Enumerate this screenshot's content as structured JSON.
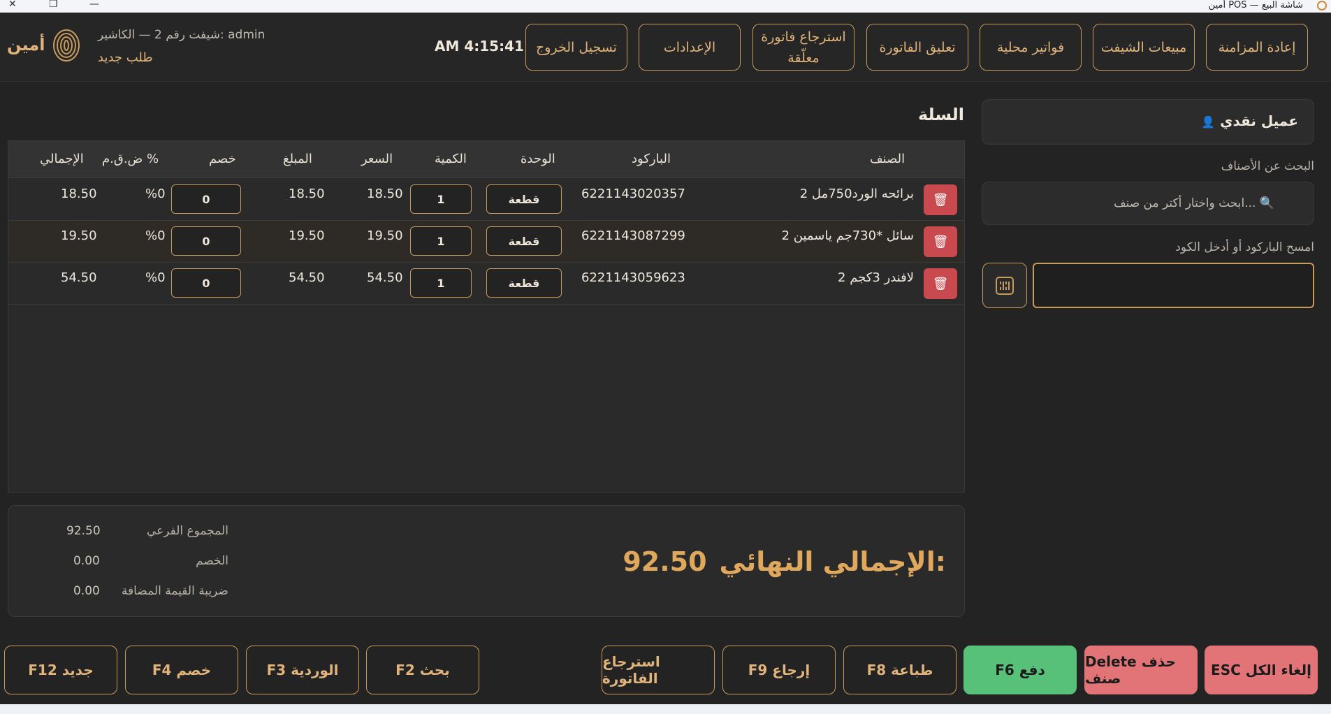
{
  "window": {
    "title": "أمين POS — شاشة البيع"
  },
  "header": {
    "buttons": [
      {
        "label": "إعادة المزامنة"
      },
      {
        "label": "مبيعات الشيفت"
      },
      {
        "label": "فواتير محلية"
      },
      {
        "label": "تعليق الفاتورة"
      },
      {
        "label": "استرجاع فاتورة معلّقة"
      },
      {
        "label": "الإعدادات"
      },
      {
        "label": "تسجيل الخروج"
      }
    ],
    "clock": "AM 4:15:41",
    "shift_info": "شيفت رقم 2 — الكاشير: admin",
    "new_order": "طلب جديد",
    "brand": "أمين"
  },
  "customer": {
    "label": "عميل نقدي",
    "icon": "user-icon"
  },
  "search": {
    "label": "البحث عن الأصناف",
    "placeholder": "ابحث واختار أكتر من صنف..."
  },
  "barcode": {
    "label": "امسح الباركود أو أدخل الكود",
    "value": ""
  },
  "cart": {
    "title": "السلة",
    "columns": {
      "item": "الصنف",
      "barcode": "الباركود",
      "unit": "الوحدة",
      "qty": "الكمية",
      "price": "السعر",
      "amount": "المبلغ",
      "discount": "خصم",
      "vat": "ض.ق.م %",
      "total": "الإجمالي"
    },
    "rows": [
      {
        "item": "2 برائحه الورد750مل",
        "barcode": "6221143020357",
        "unit": "قطعة",
        "qty": "1",
        "price": "18.50",
        "amount": "18.50",
        "discount": "0",
        "vat": "%0",
        "total": "18.50"
      },
      {
        "item": "2 سائل *730جم ياسمين",
        "barcode": "6221143087299",
        "unit": "قطعة",
        "qty": "1",
        "price": "19.50",
        "amount": "19.50",
        "discount": "0",
        "vat": "%0",
        "total": "19.50"
      },
      {
        "item": "2 لافندر 3كجم",
        "barcode": "6221143059623",
        "unit": "قطعة",
        "qty": "1",
        "price": "54.50",
        "amount": "54.50",
        "discount": "0",
        "vat": "%0",
        "total": "54.50"
      }
    ]
  },
  "totals": {
    "subtotal_label": "المجموع الفرعي",
    "subtotal": "92.50",
    "discount_label": "الخصم",
    "discount": "0.00",
    "vat_label": "ضريبة القيمة المضافة",
    "vat": "0.00",
    "grand_label": "الإجمالي النهائي:",
    "grand": "92.50"
  },
  "footer": {
    "cancel_all": "ESC إلغاء الكل",
    "delete_item": "Delete حذف صنف",
    "pay": "F6 دفع",
    "print": "F8 طباعة",
    "return": "F9 إرجاع",
    "restore_invoice": "استرجاع الفاتورة",
    "search": "F2 بحث",
    "shift": "F3 الوردية",
    "discount": "F4 خصم",
    "new": "F12 جديد"
  },
  "colors": {
    "accent": "#c89a5b",
    "pay": "#57c17a",
    "danger": "#e27477",
    "bg": "#232323"
  }
}
